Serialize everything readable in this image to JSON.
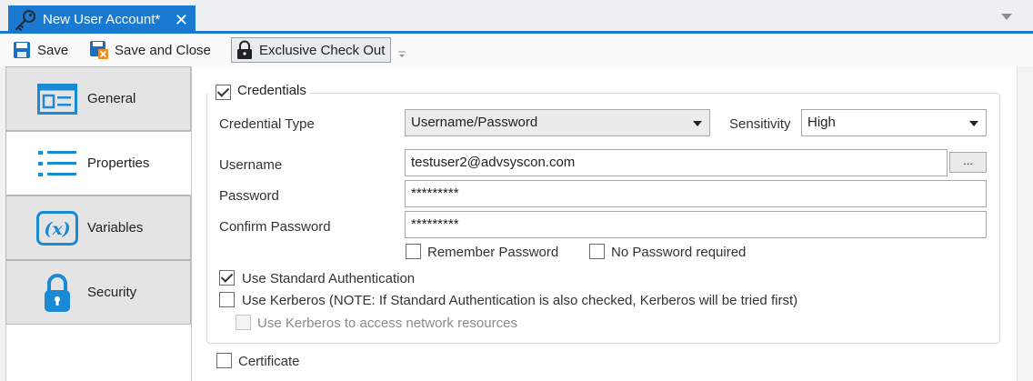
{
  "document_tab": {
    "title": "New User Account*",
    "close_glyph": "✕",
    "icon": "key-icon"
  },
  "toolbar": {
    "save_label": "Save",
    "save_close_label": "Save and Close",
    "checkout_label": "Exclusive Check Out"
  },
  "sidebar": {
    "items": [
      {
        "label": "General",
        "icon": "general-card-icon"
      },
      {
        "label": "Properties",
        "icon": "list-icon"
      },
      {
        "label": "Variables",
        "icon": "variable-x-icon"
      },
      {
        "label": "Security",
        "icon": "lock-icon"
      }
    ],
    "active_index": 1
  },
  "credentials": {
    "group_label": "Credentials",
    "group_checked": true,
    "credential_type_label": "Credential Type",
    "credential_type_value": "Username/Password",
    "sensitivity_label": "Sensitivity",
    "sensitivity_value": "High",
    "username_label": "Username",
    "username_value": "testuser2@advsyscon.com",
    "browse_label": "...",
    "password_label": "Password",
    "password_value": "*********",
    "confirm_password_label": "Confirm Password",
    "confirm_password_value": "*********",
    "remember_password_label": "Remember Password",
    "no_password_label": "No Password required",
    "use_standard_auth_label": "Use Standard Authentication",
    "use_kerberos_label": "Use Kerberos (NOTE: If Standard Authentication is also checked, Kerberos will be tried first)",
    "use_kerberos_network_label": "Use Kerberos to access network resources"
  },
  "certificate": {
    "label": "Certificate",
    "checked": false
  },
  "colors": {
    "accent": "#1a7ad1",
    "icon_blue": "#1a8ad4",
    "sidebar_bg": "#e4e4e4"
  }
}
